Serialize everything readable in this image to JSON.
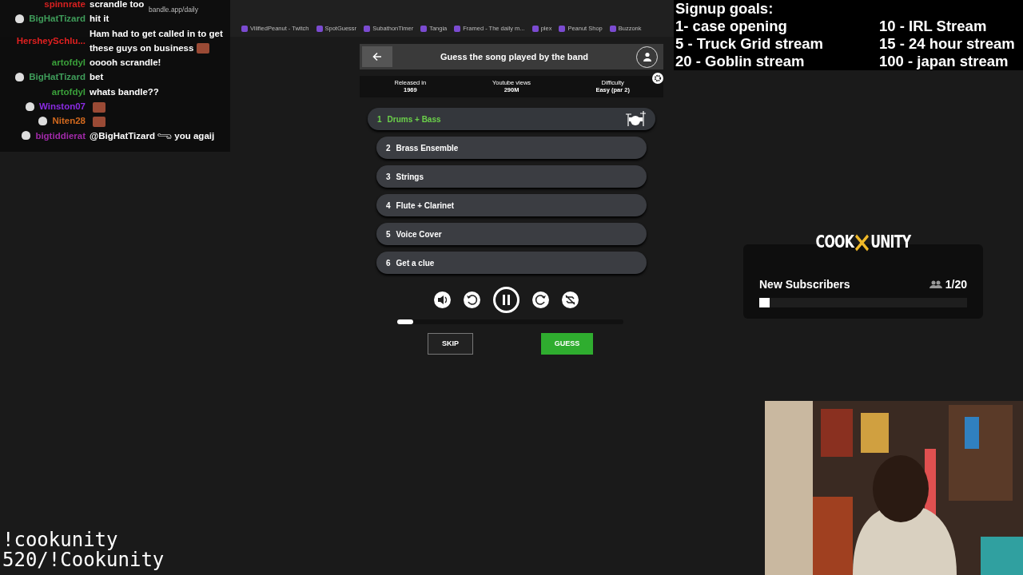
{
  "browser": {
    "address": "bandle.app/daily",
    "bookmarks": [
      "VilifiedPeanut - Twitch",
      "SpotGuessr",
      "SubathonTimer",
      "Tangia",
      "Framed - The daily m...",
      "plex",
      "Peanut Shop",
      "Buzzonk"
    ]
  },
  "chat": [
    {
      "user": "spinnrate",
      "color": "#d62020",
      "badge": false,
      "message": "scrandle too",
      "emote": false
    },
    {
      "user": "BigHatTizard",
      "color": "#3f9c5a",
      "badge": true,
      "message": "hit it",
      "emote": false
    },
    {
      "user": "HersheySchlu...",
      "color": "#e02020",
      "badge": false,
      "message": "Ham had to get called in to get these guys on business",
      "emote": true
    },
    {
      "user": "artofdyl",
      "color": "#3aa03a",
      "badge": false,
      "message": "ooooh scrandle!",
      "emote": false
    },
    {
      "user": "BigHatTizard",
      "color": "#3f9c5a",
      "badge": true,
      "message": "bet",
      "emote": false
    },
    {
      "user": "artofdyl",
      "color": "#3aa03a",
      "badge": false,
      "message": "whats bandle??",
      "emote": false
    },
    {
      "user": "Winston07",
      "color": "#8a2be2",
      "badge": true,
      "emote": true
    },
    {
      "user": "Niten28",
      "color": "#d2691e",
      "badge": true,
      "emote": true
    },
    {
      "user": "bigtiddierat",
      "color": "#a02aa8",
      "badge": true,
      "message": "@BigHatTizard 𓂸 you agaij",
      "emote": false
    }
  ],
  "game": {
    "title": "Guess the song played by the band",
    "stats": [
      {
        "label": "Released in",
        "value": "1969"
      },
      {
        "label": "Youtube views",
        "value": "290M"
      },
      {
        "label": "Difficulty",
        "value": "Easy (par 2)"
      }
    ],
    "options": [
      {
        "number": "1",
        "label": "Drums + Bass",
        "selected": true
      },
      {
        "number": "2",
        "label": "Brass Ensemble",
        "selected": false
      },
      {
        "number": "3",
        "label": "Strings",
        "selected": false
      },
      {
        "number": "4",
        "label": "Flute + Clarinet",
        "selected": false
      },
      {
        "number": "5",
        "label": "Voice Cover",
        "selected": false
      },
      {
        "number": "6",
        "label": "Get a clue",
        "selected": false
      }
    ],
    "level": 0.07,
    "skip": "SKIP",
    "guess": "GUESS"
  },
  "goals": {
    "title": "Signup goals:",
    "left": [
      "1- case opening",
      "5 - Truck Grid stream",
      "20 - Goblin stream"
    ],
    "right": [
      "10 - IRL Stream",
      "15 - 24 hour stream",
      "100 - japan stream"
    ]
  },
  "widget": {
    "brand_left": "COOK",
    "brand_right": "UNITY",
    "title": "New Subscribers",
    "count": "1/20",
    "level": 0.05
  },
  "command": [
    "!cookunity",
    "520/!Cookunity"
  ],
  "webcam": {
    "kind": "picture"
  }
}
